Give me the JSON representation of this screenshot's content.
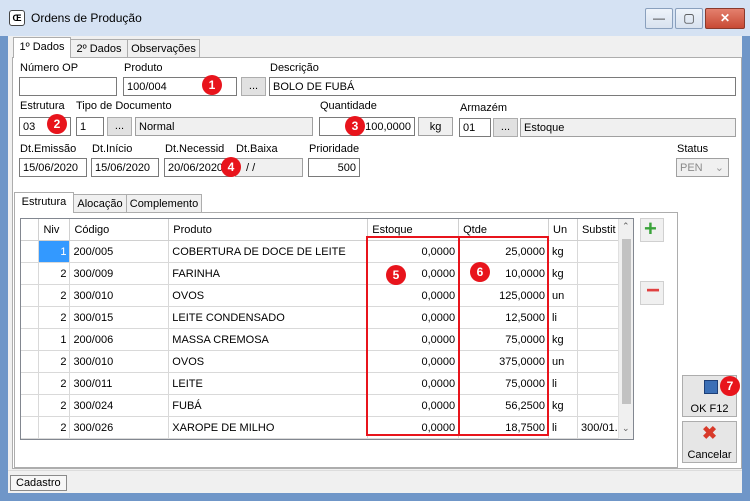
{
  "window": {
    "title": "Ordens de Produção",
    "minimize_glyph": "—",
    "maximize_glyph": "▢",
    "close_glyph": "✕",
    "app_icon": "production-order-icon"
  },
  "main_tabs": [
    "1º Dados",
    "2º Dados",
    "Observações"
  ],
  "form": {
    "numero_op_label": "Número OP",
    "numero_op_value": "",
    "produto_label": "Produto",
    "produto_value": "100/004",
    "descricao_label": "Descrição",
    "descricao_value": "BOLO DE FUBÁ",
    "estrutura_label": "Estrutura",
    "estrutura_value": "03",
    "tipo_doc_label": "Tipo de Documento",
    "tipo_doc_code": "1",
    "tipo_doc_name": "Normal",
    "quantidade_label": "Quantidade",
    "quantidade_value": "100,0000",
    "unidade_value": "kg",
    "armazem_label": "Armazém",
    "armazem_code": "01",
    "armazem_name": "Estoque",
    "dt_emissao_label": "Dt.Emissão",
    "dt_emissao_value": "15/06/2020",
    "dt_inicio_label": "Dt.Início",
    "dt_inicio_value": "15/06/2020",
    "dt_necessid_label": "Dt.Necessid",
    "dt_necessid_value": "20/06/2020",
    "dt_baixa_label": "Dt.Baixa",
    "dt_baixa_value": "/ /",
    "prioridade_label": "Prioridade",
    "prioridade_value": "500",
    "status_label": "Status",
    "status_value": "PEN",
    "dots": "..."
  },
  "sub_tabs": [
    "Estrutura",
    "Alocação",
    "Complemento"
  ],
  "grid": {
    "columns": [
      "Niv",
      "Código",
      "Produto",
      "Estoque",
      "Qtde",
      "Un",
      "Substit"
    ],
    "rows": [
      {
        "niv": "1",
        "codigo": "200/005",
        "produto": "COBERTURA DE DOCE DE LEITE",
        "estoque": "0,0000",
        "qtde": "25,0000",
        "un": "kg",
        "substit": ""
      },
      {
        "niv": "2",
        "codigo": "300/009",
        "produto": "FARINHA",
        "estoque": "0,0000",
        "qtde": "10,0000",
        "un": "kg",
        "substit": ""
      },
      {
        "niv": "2",
        "codigo": "300/010",
        "produto": "OVOS",
        "estoque": "0,0000",
        "qtde": "125,0000",
        "un": "un",
        "substit": ""
      },
      {
        "niv": "2",
        "codigo": "300/015",
        "produto": "LEITE CONDENSADO",
        "estoque": "0,0000",
        "qtde": "12,5000",
        "un": "li",
        "substit": ""
      },
      {
        "niv": "1",
        "codigo": "200/006",
        "produto": "MASSA CREMOSA",
        "estoque": "0,0000",
        "qtde": "75,0000",
        "un": "kg",
        "substit": ""
      },
      {
        "niv": "2",
        "codigo": "300/010",
        "produto": "OVOS",
        "estoque": "0,0000",
        "qtde": "375,0000",
        "un": "un",
        "substit": ""
      },
      {
        "niv": "2",
        "codigo": "300/011",
        "produto": "LEITE",
        "estoque": "0,0000",
        "qtde": "75,0000",
        "un": "li",
        "substit": ""
      },
      {
        "niv": "2",
        "codigo": "300/024",
        "produto": "FUBÁ",
        "estoque": "0,0000",
        "qtde": "56,2500",
        "un": "kg",
        "substit": ""
      },
      {
        "niv": "2",
        "codigo": "300/026",
        "produto": "XAROPE DE MILHO",
        "estoque": "0,0000",
        "qtde": "18,7500",
        "un": "li",
        "substit": "300/01..."
      }
    ]
  },
  "buttons": {
    "add_glyph": "+",
    "remove_glyph": "−",
    "ok_label": "OK  F12",
    "cancel_label": "Cancelar"
  },
  "status_bar": {
    "tab_label": "Cadastro"
  },
  "annotations": [
    "1",
    "2",
    "3",
    "4",
    "5",
    "6",
    "7"
  ],
  "colors": {
    "annotation_red": "#e8141c",
    "selection_blue": "#3399ff",
    "add_green": "#3aa33a",
    "remove_red": "#e04040"
  }
}
